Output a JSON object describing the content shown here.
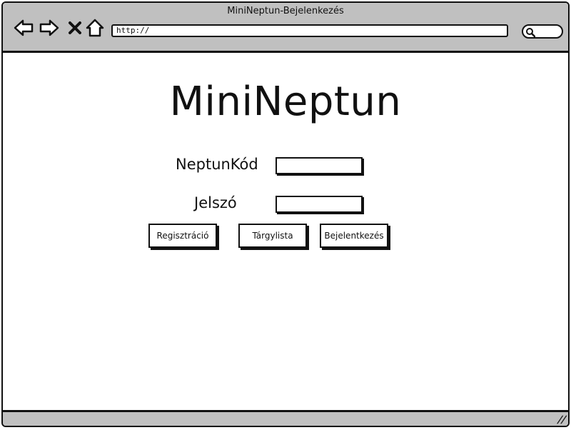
{
  "window": {
    "title": "MiniNeptun-Bejelenkezés"
  },
  "toolbar": {
    "back_icon": "back-arrow-icon",
    "forward_icon": "forward-arrow-icon",
    "close_icon": "close-x-icon",
    "home_icon": "home-icon",
    "address_value": "http://",
    "search_icon": "search-icon"
  },
  "login": {
    "app_title": "MiniNeptun",
    "neptun_code_label": "NeptunKód",
    "neptun_code_value": "",
    "password_label": "Jelszó",
    "password_value": ""
  },
  "buttons": {
    "register": "Regisztráció",
    "course_list": "Tárgylista",
    "login": "Bejelentkezés"
  },
  "statusbar": {
    "resize_grip": "//"
  }
}
